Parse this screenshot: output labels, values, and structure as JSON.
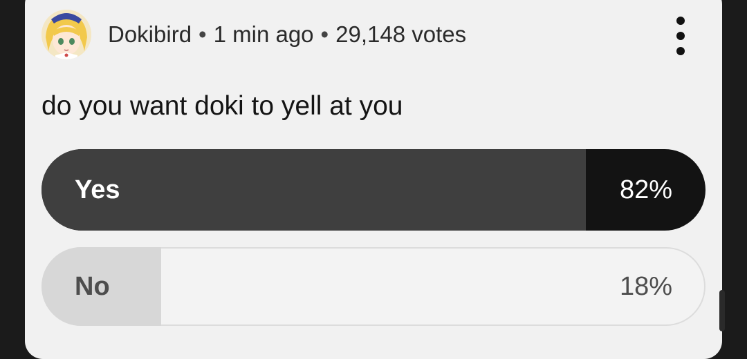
{
  "post": {
    "author": "Dokibird",
    "time_ago": "1 min ago",
    "votes": "29,148 votes",
    "separator": "•",
    "avatar_icon": "vtuber-avatar-icon",
    "menu_icon": "more-vert-icon"
  },
  "poll": {
    "question": "do you want doki to yell at you",
    "options": [
      {
        "label": "Yes",
        "percent_text": "82%",
        "fraction": 0.82,
        "fill_color": "#3f3f3f",
        "track_color": "#131313"
      },
      {
        "label": "No",
        "percent_text": "18%",
        "fraction": 0.18,
        "fill_color": "#d7d7d7",
        "track_color": "#f3f3f3"
      }
    ]
  }
}
